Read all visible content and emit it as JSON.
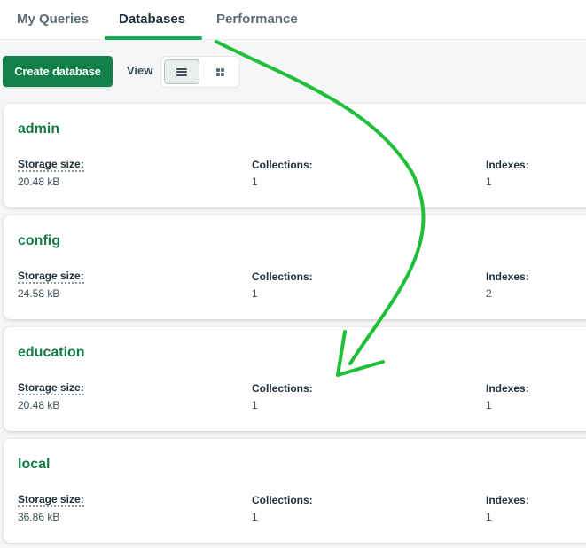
{
  "tabs": [
    {
      "label": "My Queries"
    },
    {
      "label": "Databases"
    },
    {
      "label": "Performance"
    }
  ],
  "toolbar": {
    "create_label": "Create database",
    "view_label": "View"
  },
  "databases": [
    {
      "name": "admin",
      "storage_label": "Storage size:",
      "storage": "20.48 kB",
      "collections_label": "Collections:",
      "collections": "1",
      "indexes_label": "Indexes:",
      "indexes": "1"
    },
    {
      "name": "config",
      "storage_label": "Storage size:",
      "storage": "24.58 kB",
      "collections_label": "Collections:",
      "collections": "1",
      "indexes_label": "Indexes:",
      "indexes": "2"
    },
    {
      "name": "education",
      "storage_label": "Storage size:",
      "storage": "20.48 kB",
      "collections_label": "Collections:",
      "collections": "1",
      "indexes_label": "Indexes:",
      "indexes": "1"
    },
    {
      "name": "local",
      "storage_label": "Storage size:",
      "storage": "36.86 kB",
      "collections_label": "Collections:",
      "collections": "1",
      "indexes_label": "Indexes:",
      "indexes": "1"
    }
  ],
  "colors": {
    "accent": "#13aa52",
    "button": "#13804a",
    "db_name": "#137a49",
    "annotation_arrow": "#1fbf3a"
  },
  "icons": {
    "list_view": "list-icon",
    "grid_view": "grid-icon"
  }
}
